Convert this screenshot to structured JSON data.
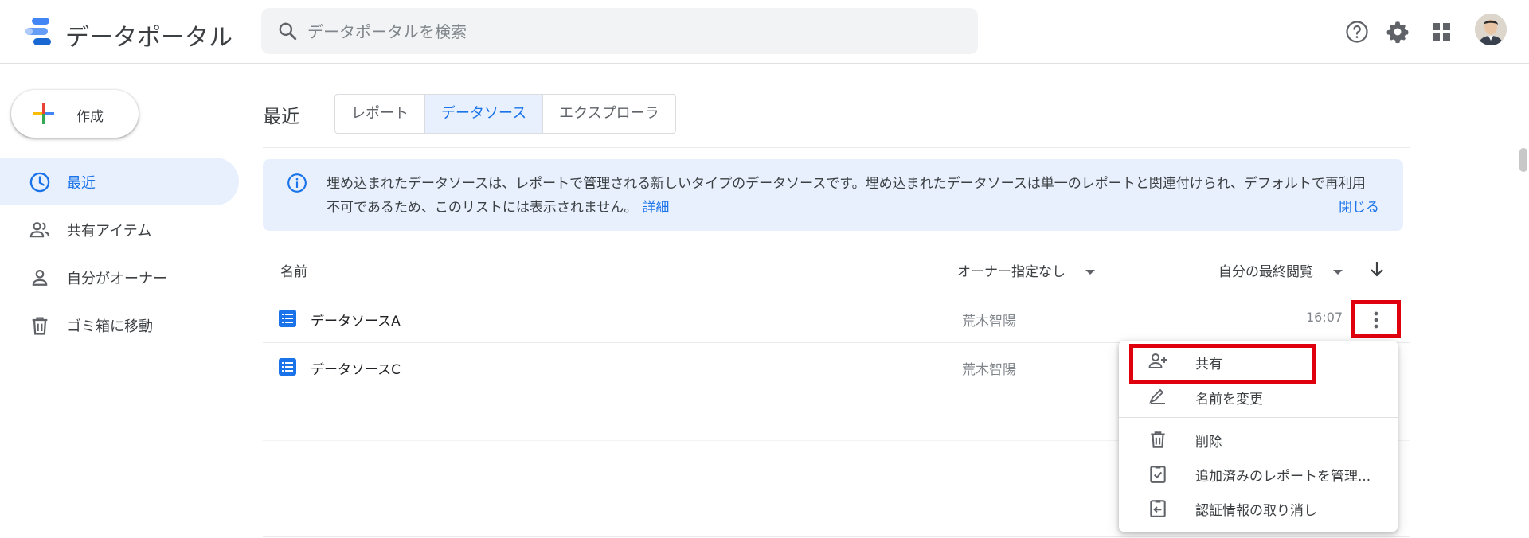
{
  "app": {
    "title": "データポータル"
  },
  "search": {
    "placeholder": "データポータルを検索"
  },
  "header_icons": [
    "help-icon",
    "settings-icon",
    "apps-grid-icon",
    "avatar"
  ],
  "sidebar": {
    "create_label": "作成",
    "items": [
      {
        "label": "最近",
        "icon": "clock-icon",
        "active": true
      },
      {
        "label": "共有アイテム",
        "icon": "people-icon",
        "active": false
      },
      {
        "label": "自分がオーナー",
        "icon": "person-icon",
        "active": false
      },
      {
        "label": "ゴミ箱に移動",
        "icon": "trash-icon",
        "active": false
      }
    ]
  },
  "main": {
    "section_title": "最近",
    "tabs": [
      {
        "label": "レポート",
        "selected": false
      },
      {
        "label": "データソース",
        "selected": true
      },
      {
        "label": "エクスプローラ",
        "selected": false
      }
    ],
    "banner": {
      "text": "埋め込まれたデータソースは、レポートで管理される新しいタイプのデータソースです。埋め込まれたデータソースは単一のレポートと関連付けられ、デフォルトで再利用不可であるため、このリストには表示されません。",
      "link": "詳細",
      "close": "閉じる"
    },
    "columns": {
      "name": "名前",
      "owner_filter": "オーナー指定なし",
      "sort": "自分の最終閲覧"
    },
    "rows": [
      {
        "name": "データソースA",
        "owner": "荒木智陽",
        "time": "16:07"
      },
      {
        "name": "データソースC",
        "owner": "荒木智陽",
        "time": ""
      }
    ]
  },
  "context_menu": {
    "items": [
      {
        "label": "共有",
        "icon": "person-add-icon"
      },
      {
        "label": "名前を変更",
        "icon": "rename-icon"
      },
      {
        "label": "削除",
        "icon": "trash-icon"
      },
      {
        "label": "追加済みのレポートを管理...",
        "icon": "clipboard-check-icon"
      },
      {
        "label": "認証情報の取り消し",
        "icon": "clipboard-revoke-icon"
      }
    ]
  },
  "colors": {
    "accent": "#1a73e8",
    "highlight_red": "#e0000d",
    "active_bg": "#e8f0fe"
  }
}
